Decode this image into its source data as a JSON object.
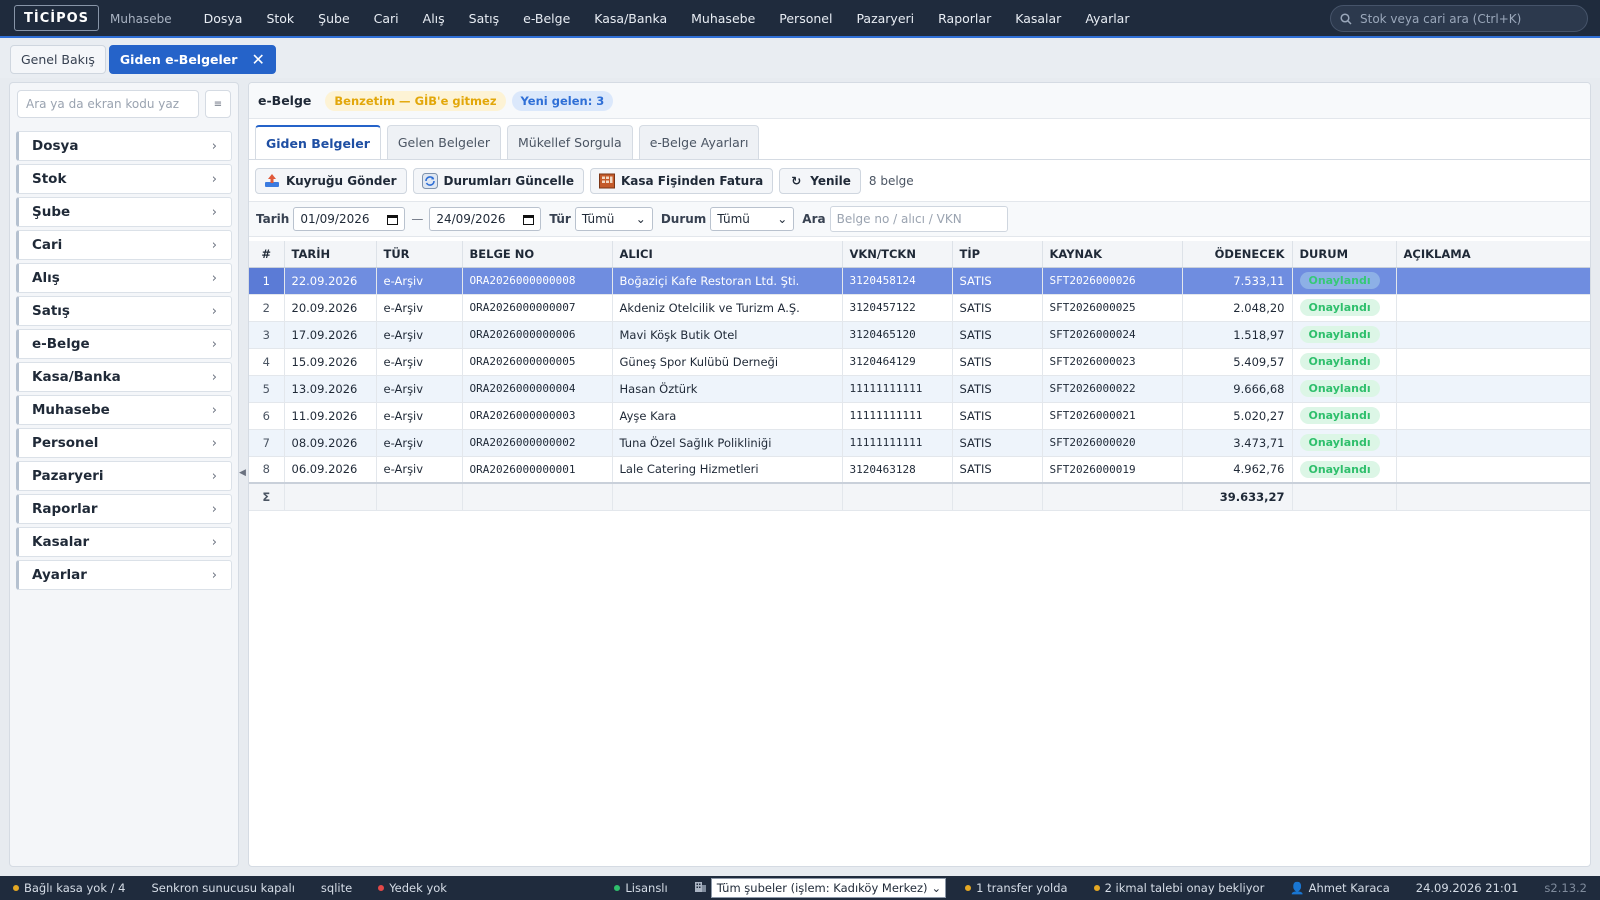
{
  "app": {
    "logo": "TİCİPOS",
    "subtitle": "Muhasebe"
  },
  "top_menu": [
    "Dosya",
    "Stok",
    "Şube",
    "Cari",
    "Alış",
    "Satış",
    "e-Belge",
    "Kasa/Banka",
    "Muhasebe",
    "Personel",
    "Pazaryeri",
    "Raporlar",
    "Kasalar",
    "Ayarlar"
  ],
  "top_search": {
    "placeholder": "Stok veya cari ara (Ctrl+K)"
  },
  "page_tabs": [
    {
      "label": "Genel Bakış",
      "active": false
    },
    {
      "label": "Giden e-Belgeler",
      "active": true
    }
  ],
  "sidebar": {
    "search_placeholder": "Ara ya da ekran kodu yaz",
    "items": [
      "Dosya",
      "Stok",
      "Şube",
      "Cari",
      "Alış",
      "Satış",
      "e-Belge",
      "Kasa/Banka",
      "Muhasebe",
      "Personel",
      "Pazaryeri",
      "Raporlar",
      "Kasalar",
      "Ayarlar"
    ]
  },
  "panel": {
    "title": "e-Belge",
    "badge_sim": "Benzetim — GİB'e gitmez",
    "badge_new": "Yeni gelen: 3",
    "tabs": [
      "Giden Belgeler",
      "Gelen Belgeler",
      "Mükellef Sorgula",
      "e-Belge Ayarları"
    ],
    "toolbar": {
      "send_queue": "Kuyruğu Gönder",
      "update_status": "Durumları Güncelle",
      "from_receipt": "Kasa Fişinden Fatura",
      "refresh": "Yenile",
      "count": "8 belge"
    },
    "filters": {
      "date_label": "Tarih",
      "date_from": "01/09/2026",
      "date_to": "24/09/2026",
      "type_label": "Tür",
      "type_value": "Tümü",
      "status_label": "Durum",
      "status_value": "Tümü",
      "search_label": "Ara",
      "search_placeholder": "Belge no / alıcı / VKN"
    }
  },
  "table": {
    "columns": [
      "#",
      "TARİH",
      "TÜR",
      "BELGE NO",
      "ALICI",
      "VKN/TCKN",
      "TİP",
      "KAYNAK",
      "ÖDENECEK",
      "DURUM",
      "AÇIKLAMA"
    ],
    "rows": [
      {
        "idx": "1",
        "date": "22.09.2026",
        "type": "e-Arşiv",
        "doc_no": "ORA2026000000008",
        "buyer": "Boğaziçi Kafe Restoran Ltd. Şti.",
        "vkn": "3120458124",
        "kind": "SATIS",
        "source": "SFT2026000026",
        "amount": "7.533,11",
        "status": "Onaylandı",
        "note": ""
      },
      {
        "idx": "2",
        "date": "20.09.2026",
        "type": "e-Arşiv",
        "doc_no": "ORA2026000000007",
        "buyer": "Akdeniz Otelcilik ve Turizm A.Ş.",
        "vkn": "3120457122",
        "kind": "SATIS",
        "source": "SFT2026000025",
        "amount": "2.048,20",
        "status": "Onaylandı",
        "note": ""
      },
      {
        "idx": "3",
        "date": "17.09.2026",
        "type": "e-Arşiv",
        "doc_no": "ORA2026000000006",
        "buyer": "Mavi Köşk Butik Otel",
        "vkn": "3120465120",
        "kind": "SATIS",
        "source": "SFT2026000024",
        "amount": "1.518,97",
        "status": "Onaylandı",
        "note": ""
      },
      {
        "idx": "4",
        "date": "15.09.2026",
        "type": "e-Arşiv",
        "doc_no": "ORA2026000000005",
        "buyer": "Güneş Spor Kulübü Derneği",
        "vkn": "3120464129",
        "kind": "SATIS",
        "source": "SFT2026000023",
        "amount": "5.409,57",
        "status": "Onaylandı",
        "note": ""
      },
      {
        "idx": "5",
        "date": "13.09.2026",
        "type": "e-Arşiv",
        "doc_no": "ORA2026000000004",
        "buyer": "Hasan Öztürk",
        "vkn": "11111111111",
        "kind": "SATIS",
        "source": "SFT2026000022",
        "amount": "9.666,68",
        "status": "Onaylandı",
        "note": ""
      },
      {
        "idx": "6",
        "date": "11.09.2026",
        "type": "e-Arşiv",
        "doc_no": "ORA2026000000003",
        "buyer": "Ayşe Kara",
        "vkn": "11111111111",
        "kind": "SATIS",
        "source": "SFT2026000021",
        "amount": "5.020,27",
        "status": "Onaylandı",
        "note": ""
      },
      {
        "idx": "7",
        "date": "08.09.2026",
        "type": "e-Arşiv",
        "doc_no": "ORA2026000000002",
        "buyer": "Tuna Özel Sağlık Polikliniği",
        "vkn": "11111111111",
        "kind": "SATIS",
        "source": "SFT2026000020",
        "amount": "3.473,71",
        "status": "Onaylandı",
        "note": ""
      },
      {
        "idx": "8",
        "date": "06.09.2026",
        "type": "e-Arşiv",
        "doc_no": "ORA2026000000001",
        "buyer": "Lale Catering Hizmetleri",
        "vkn": "3120463128",
        "kind": "SATIS",
        "source": "SFT2026000019",
        "amount": "4.962,76",
        "status": "Onaylandı",
        "note": ""
      }
    ],
    "total_symbol": "Σ",
    "total_amount": "39.633,27"
  },
  "statusbar": {
    "cash": "Bağlı kasa yok / 4",
    "sync": "Senkron sunucusu kapalı",
    "db": "sqlite",
    "backup": "Yedek yok",
    "license": "Lisanslı",
    "branch_select": "Tüm şubeler (işlem: Kadıköy Merkez)",
    "transfer": "1 transfer yolda",
    "supply": "2 ikmal talebi onay bekliyor",
    "user": "Ahmet Karaca",
    "datetime": "24.09.2026 21:01",
    "version": "s2.13.2"
  },
  "colors": {
    "accent": "#2563c9",
    "topbar": "#1f2b3d",
    "selected_row": "#6f8de0",
    "status_ok": "#2fbf6c",
    "warn": "#e2a70a"
  }
}
